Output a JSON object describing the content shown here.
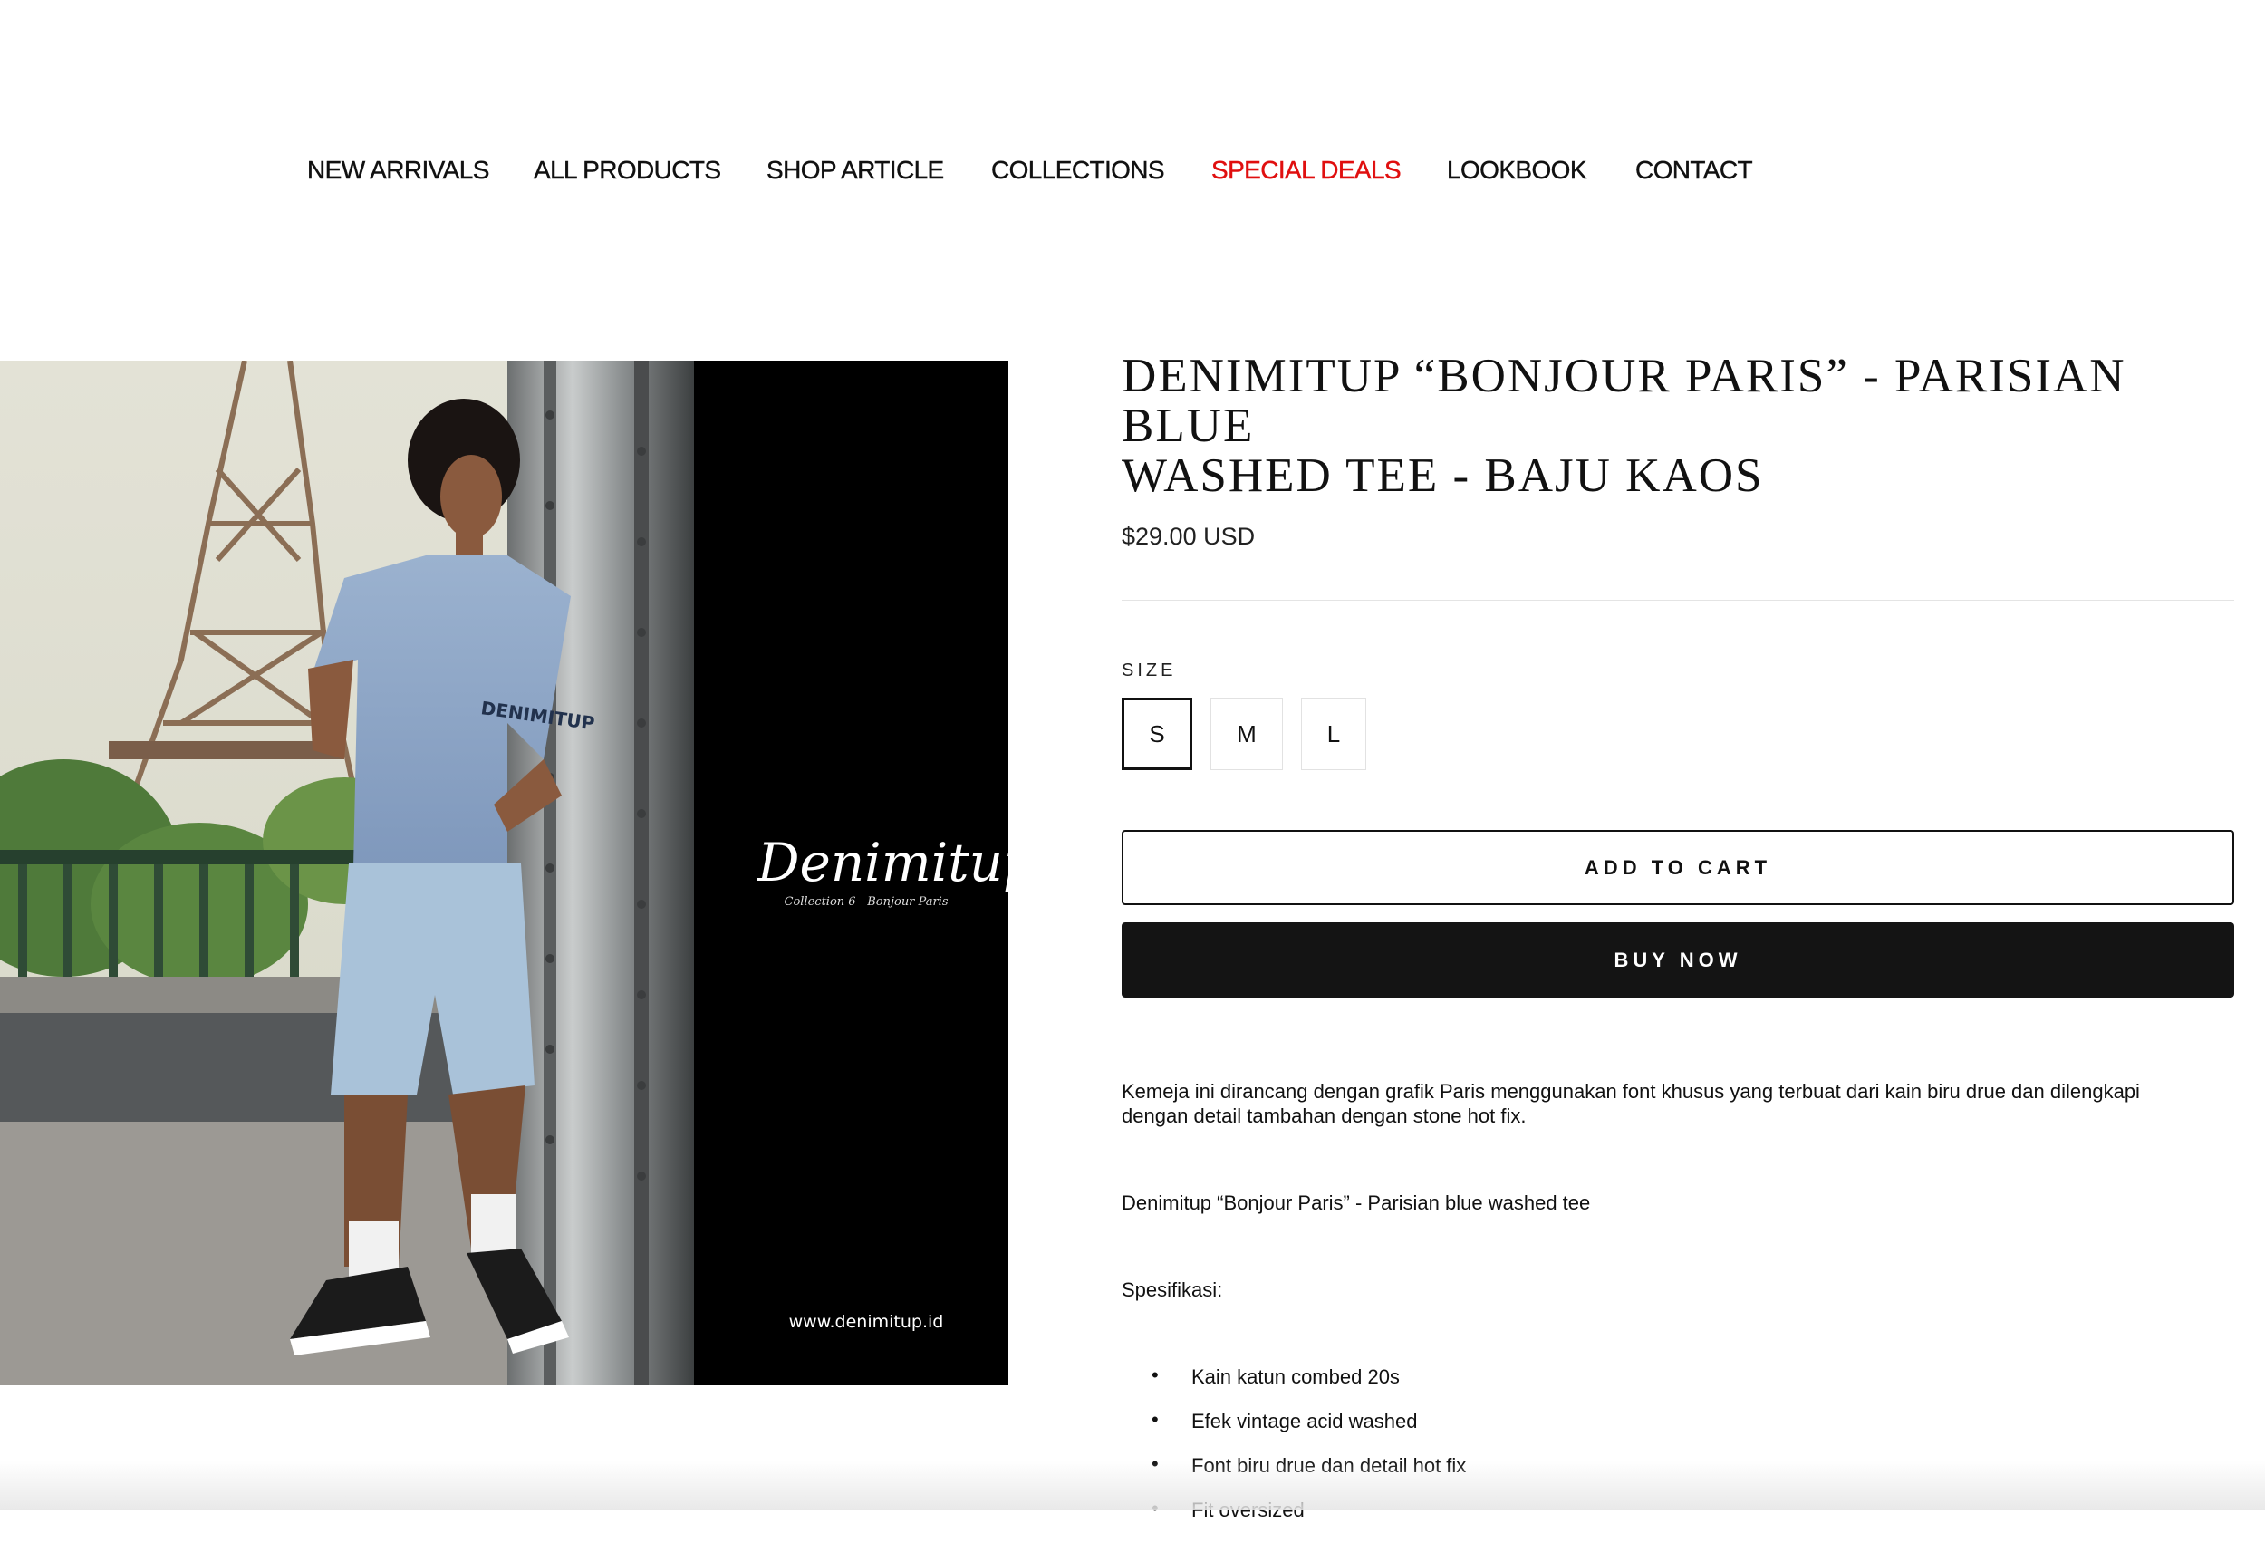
{
  "nav": {
    "items": [
      {
        "label": "NEW ARRIVALS"
      },
      {
        "label": "ALL PRODUCTS"
      },
      {
        "label": "SHOP ARTICLE"
      },
      {
        "label": "COLLECTIONS"
      },
      {
        "label": "SPECIAL DEALS"
      },
      {
        "label": "LOOKBOOK"
      },
      {
        "label": "CONTACT"
      }
    ],
    "accent_color": "#e00f0f"
  },
  "image": {
    "brand": "Denimitup",
    "brand_sub": "Collection 6 - Bonjour Paris",
    "url": "www.denimitup.id",
    "shirt_print": "DENIMITUP"
  },
  "product": {
    "title_line1": "DENIMITUP “BONJOUR PARIS” - PARISIAN BLUE",
    "title_line2": "WASHED TEE - BAJU KAOS",
    "price": "$29.00 USD",
    "size_label": "SIZE",
    "sizes": [
      "S",
      "M",
      "L"
    ],
    "selected_size": "S",
    "add_to_cart": "ADD TO CART",
    "buy_now": "BUY NOW",
    "description": "Kemeja ini dirancang dengan grafik Paris menggunakan font khusus yang terbuat dari kain biru drue dan dilengkapi dengan detail tambahan dengan stone hot fix.",
    "product_line": "Denimitup “Bonjour Paris” - Parisian blue washed tee",
    "spec_title": "Spesifikasi:",
    "specs": [
      "Kain katun combed 20s",
      "Efek vintage acid washed",
      "Font biru drue dan detail hot fix",
      "Fit oversized"
    ],
    "bullet": "•"
  }
}
